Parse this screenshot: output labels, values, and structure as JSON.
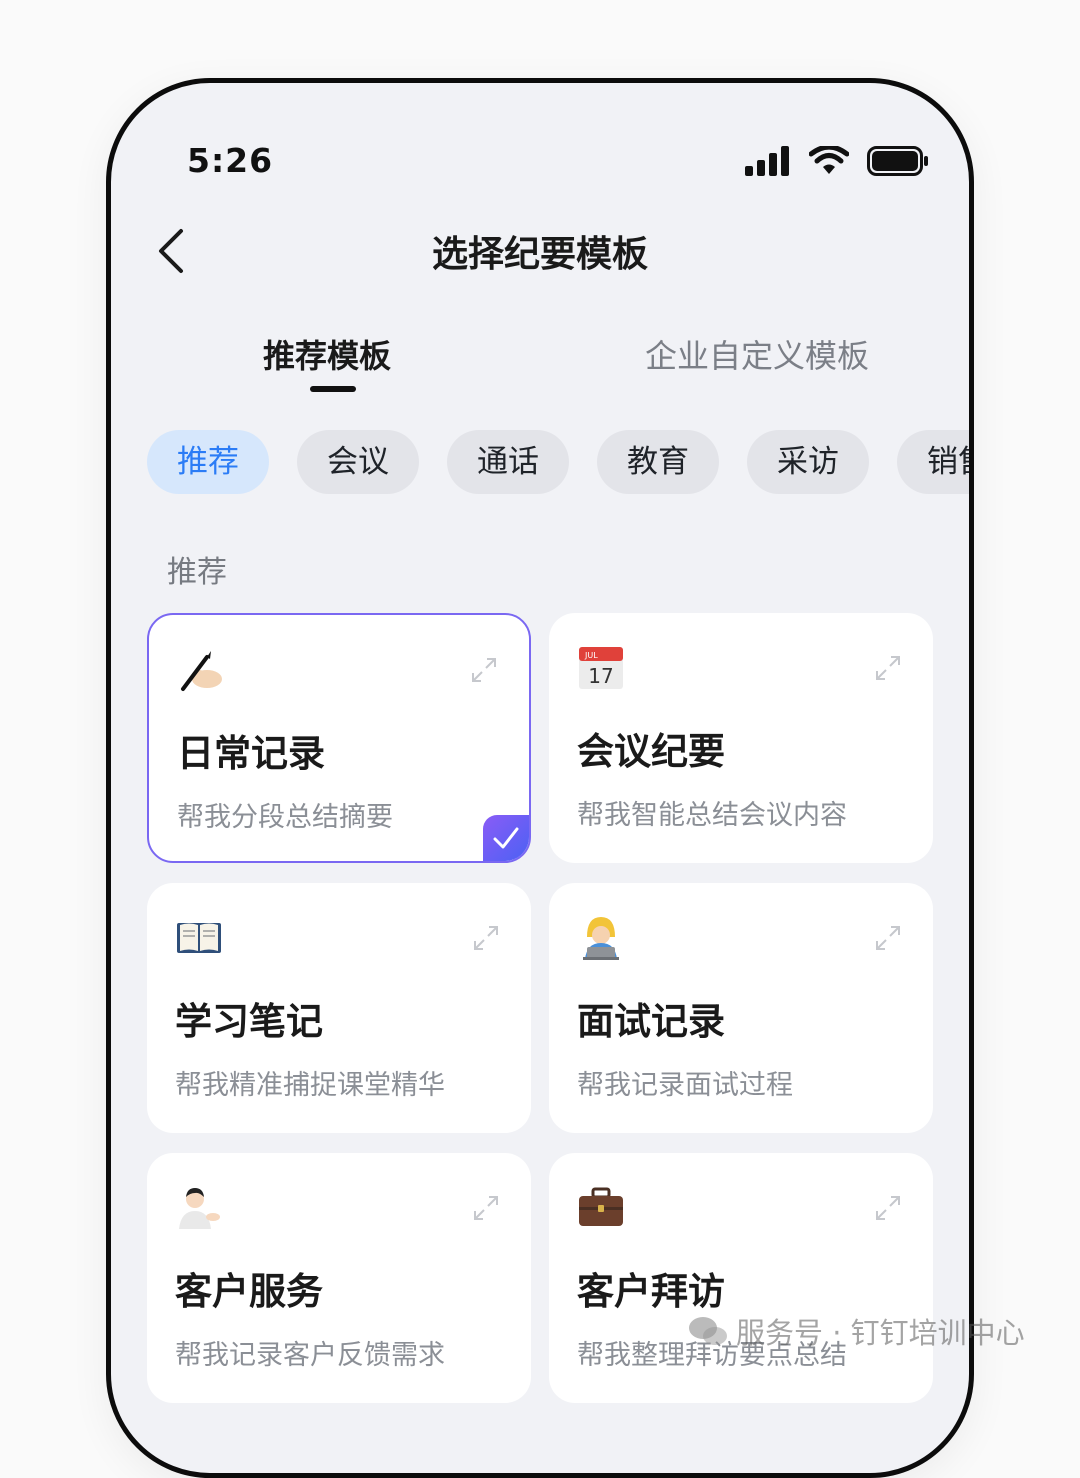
{
  "status_bar": {
    "time": "5:26"
  },
  "header": {
    "title": "选择纪要模板"
  },
  "tabs": [
    {
      "label": "推荐模板",
      "active": true
    },
    {
      "label": "企业自定义模板",
      "active": false
    }
  ],
  "categories": [
    "推荐",
    "会议",
    "通话",
    "教育",
    "采访",
    "销售"
  ],
  "active_category": "推荐",
  "section": {
    "label": "推荐"
  },
  "templates": [
    {
      "icon": "writing-hand-icon",
      "title": "日常记录",
      "desc": "帮我分段总结摘要",
      "selected": true
    },
    {
      "icon": "calendar-icon",
      "title": "会议纪要",
      "desc": "帮我智能总结会议内容",
      "selected": false,
      "icon_text": "17"
    },
    {
      "icon": "open-book-icon",
      "title": "学习笔记",
      "desc": "帮我精准捕捉课堂精华",
      "selected": false
    },
    {
      "icon": "person-laptop-icon",
      "title": "面试记录",
      "desc": "帮我记录面试过程",
      "selected": false
    },
    {
      "icon": "person-tipping-hand-icon",
      "title": "客户服务",
      "desc": "帮我记录客户反馈需求",
      "selected": false
    },
    {
      "icon": "briefcase-icon",
      "title": "客户拜访",
      "desc": "帮我整理拜访要点总结",
      "selected": false
    }
  ],
  "calendar_month": "JUL",
  "watermark": {
    "text": "服务号 · 钉钉培训中心"
  },
  "colors": {
    "accent": "#2b7cf6",
    "selected_border": "#7a68f2",
    "background": "#f1f2f6"
  }
}
